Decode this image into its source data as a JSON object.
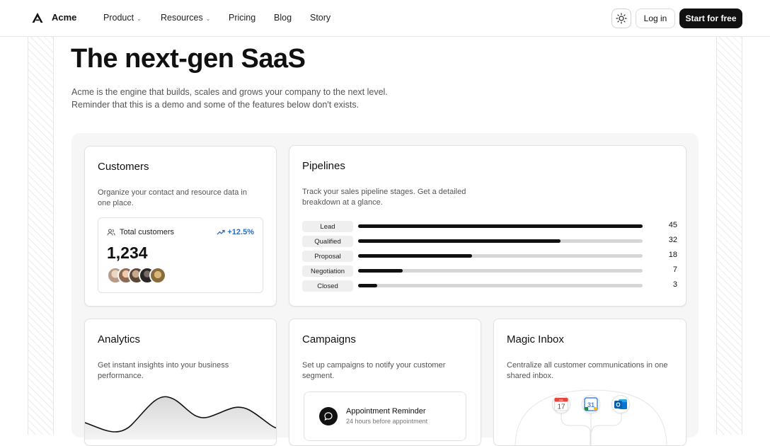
{
  "nav": {
    "brand": "Acme",
    "links": [
      "Product",
      "Resources",
      "Pricing",
      "Blog",
      "Story"
    ],
    "login": "Log in",
    "cta": "Start for free"
  },
  "hero": {
    "title": "The next-gen SaaS",
    "sub1": "Acme is the engine that builds, scales and grows your company to the next level.",
    "sub2": "Reminder that this is a demo and some of the features below don't exists."
  },
  "customers": {
    "title": "Customers",
    "desc1": "Organize your contact and resource data in",
    "desc2": "one place.",
    "stat_label": "Total customers",
    "trend": "+12.5%",
    "value": "1,234"
  },
  "pipelines": {
    "title": "Pipelines",
    "desc1": "Track your sales pipeline stages. Get a detailed",
    "desc2": "breakdown at a glance.",
    "max": 45,
    "stages": [
      {
        "label": "Lead",
        "count": 45
      },
      {
        "label": "Qualified",
        "count": 32
      },
      {
        "label": "Proposal",
        "count": 18
      },
      {
        "label": "Negotiation",
        "count": 7
      },
      {
        "label": "Closed",
        "count": 3
      }
    ]
  },
  "analytics": {
    "title": "Analytics",
    "desc1": "Get instant insights into your business",
    "desc2": "performance."
  },
  "campaigns": {
    "title": "Campaigns",
    "desc1": "Set up campaigns to notify your customer",
    "desc2": "segment.",
    "reminder_title": "Appointment Reminder",
    "reminder_sub": "24 hours before appointment"
  },
  "inbox": {
    "title": "Magic Inbox",
    "desc1": "Centralize all customer communications in one",
    "desc2": "shared inbox.",
    "cal1_month": "JUL",
    "cal1_day": "17",
    "cal2_day": "31",
    "outlook_letter": "O"
  }
}
